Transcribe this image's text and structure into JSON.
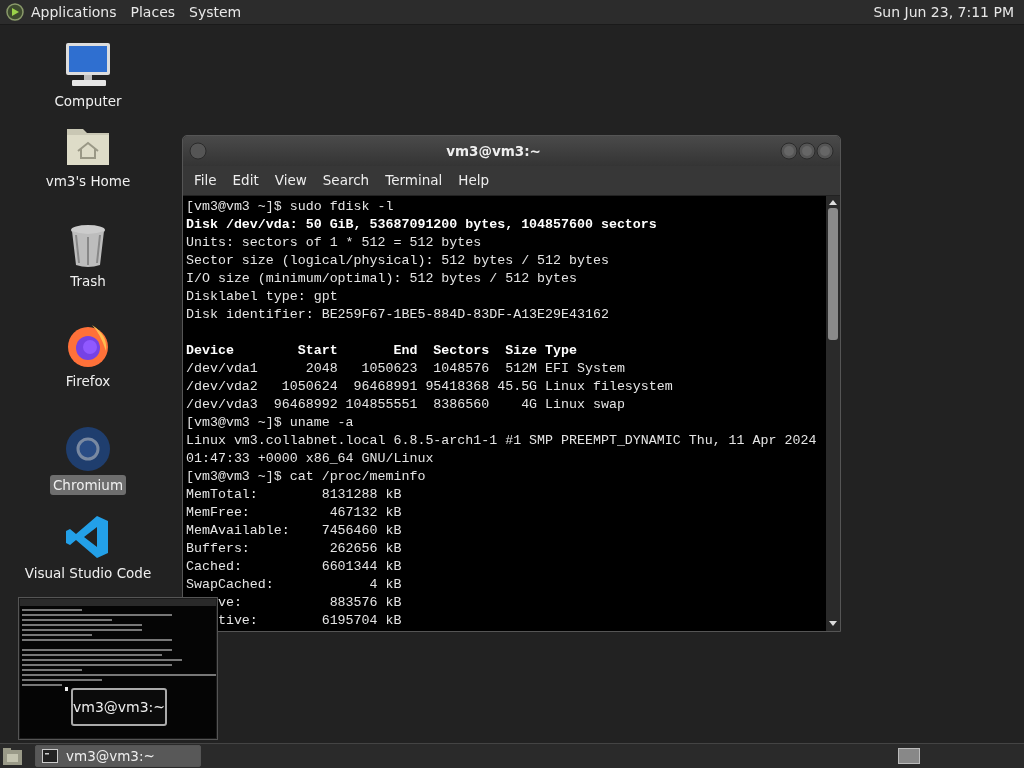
{
  "top_panel": {
    "menus": [
      {
        "label": "Applications"
      },
      {
        "label": "Places"
      },
      {
        "label": "System"
      }
    ],
    "clock": "Sun Jun 23,  7:11 PM"
  },
  "desktop_icons": [
    {
      "label": "Computer",
      "kind": "computer",
      "selected": false
    },
    {
      "label": "vm3's Home",
      "kind": "home",
      "selected": false
    },
    {
      "label": "Trash",
      "kind": "trash",
      "selected": false
    },
    {
      "label": "Firefox",
      "kind": "firefox",
      "selected": false
    },
    {
      "label": "Chromium",
      "kind": "chromium",
      "selected": true
    },
    {
      "label": "Visual Studio Code",
      "kind": "vscode",
      "selected": false
    }
  ],
  "terminal": {
    "title": "vm3@vm3:~",
    "menu": [
      "File",
      "Edit",
      "View",
      "Search",
      "Terminal",
      "Help"
    ],
    "lines": [
      {
        "kind": "normal",
        "text": "[vm3@vm3 ~]$ sudo fdisk -l"
      },
      {
        "kind": "bold",
        "text": "Disk /dev/vda: 50 GiB, 53687091200 bytes, 104857600 sectors"
      },
      {
        "kind": "normal",
        "text": "Units: sectors of 1 * 512 = 512 bytes"
      },
      {
        "kind": "normal",
        "text": "Sector size (logical/physical): 512 bytes / 512 bytes"
      },
      {
        "kind": "normal",
        "text": "I/O size (minimum/optimal): 512 bytes / 512 bytes"
      },
      {
        "kind": "normal",
        "text": "Disklabel type: gpt"
      },
      {
        "kind": "normal",
        "text": "Disk identifier: BE259F67-1BE5-884D-83DF-A13E29E43162"
      },
      {
        "kind": "blank"
      },
      {
        "kind": "bold",
        "text": "Device        Start       End  Sectors  Size Type"
      },
      {
        "kind": "normal",
        "text": "/dev/vda1      2048   1050623  1048576  512M EFI System"
      },
      {
        "kind": "normal",
        "text": "/dev/vda2   1050624  96468991 95418368 45.5G Linux filesystem"
      },
      {
        "kind": "normal",
        "text": "/dev/vda3  96468992 104855551  8386560    4G Linux swap"
      },
      {
        "kind": "normal",
        "text": "[vm3@vm3 ~]$ uname -a"
      },
      {
        "kind": "normal",
        "text": "Linux vm3.collabnet.local 6.8.5-arch1-1 #1 SMP PREEMPT_DYNAMIC Thu, 11 Apr 2024"
      },
      {
        "kind": "normal",
        "text": "01:47:33 +0000 x86_64 GNU/Linux"
      },
      {
        "kind": "normal",
        "text": "[vm3@vm3 ~]$ cat /proc/meminfo"
      },
      {
        "kind": "normal",
        "text": "MemTotal:        8131288 kB"
      },
      {
        "kind": "normal",
        "text": "MemFree:          467132 kB"
      },
      {
        "kind": "normal",
        "text": "MemAvailable:    7456460 kB"
      },
      {
        "kind": "normal",
        "text": "Buffers:          262656 kB"
      },
      {
        "kind": "normal",
        "text": "Cached:          6601344 kB"
      },
      {
        "kind": "normal",
        "text": "SwapCached:            4 kB"
      },
      {
        "kind": "normal",
        "text": "    ve:           883576 kB"
      },
      {
        "kind": "normal",
        "text": "    tive:        6195704 kB"
      }
    ]
  },
  "preview": {
    "title": "vm3@vm3:~"
  },
  "taskbar": {
    "tasks": [
      {
        "label": "vm3@vm3:~",
        "selected": true
      }
    ]
  }
}
